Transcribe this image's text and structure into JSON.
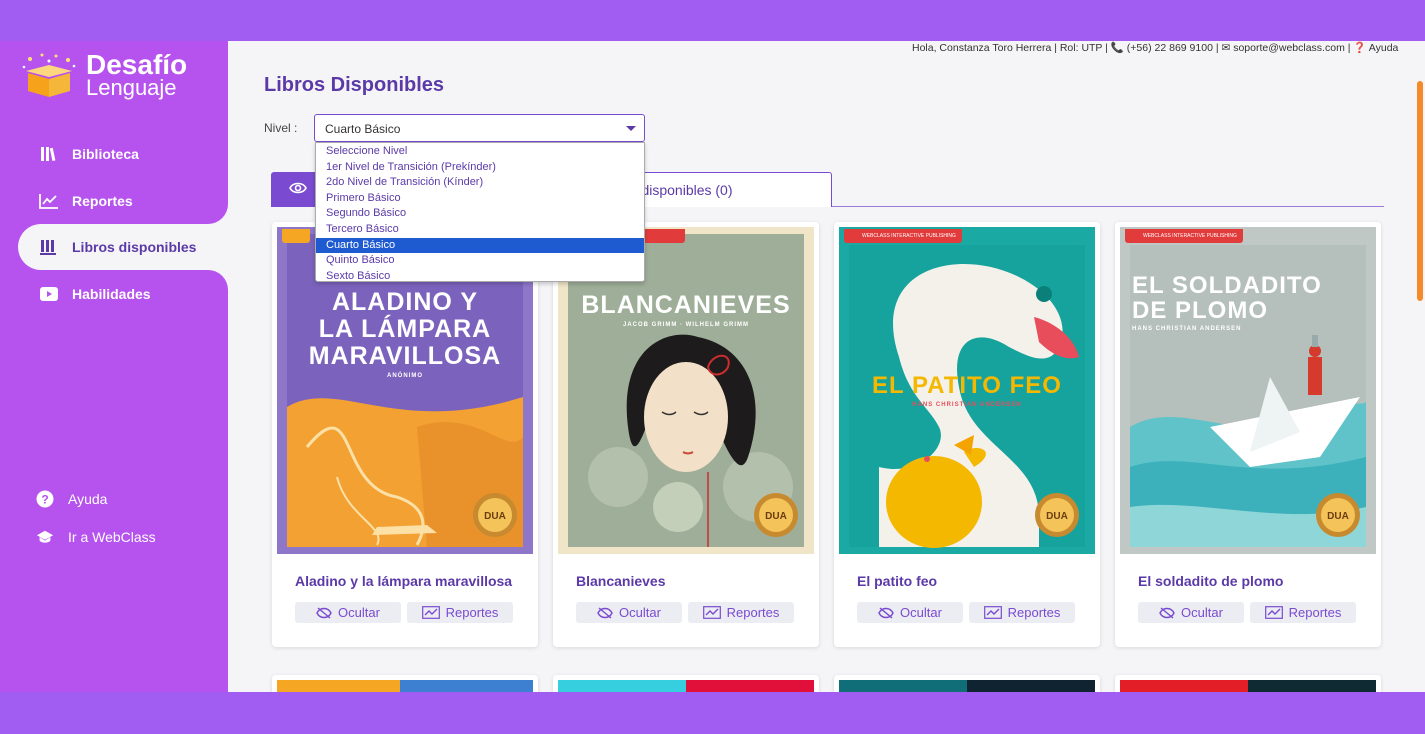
{
  "app": {
    "logo_line1": "Desafío",
    "logo_line2": "Lenguaje"
  },
  "topbar": {
    "text": "Hola, Constanza Toro Herrera | Rol: UTP | 📞 (+56) 22 869 9100 | ✉ soporte@webclass.com | ❓ Ayuda"
  },
  "sidebar": {
    "items": [
      {
        "label": "Biblioteca",
        "icon": "books-icon"
      },
      {
        "label": "Reportes",
        "icon": "chart-icon"
      },
      {
        "label": "Libros disponibles",
        "icon": "library-icon"
      },
      {
        "label": "Habilidades",
        "icon": "play-icon"
      }
    ],
    "bottom": [
      {
        "label": "Ayuda",
        "icon": "question-icon"
      },
      {
        "label": "Ir a WebClass",
        "icon": "graduation-cap-icon"
      }
    ]
  },
  "main": {
    "title": "Libros Disponibles",
    "nivel_label": "Nivel :",
    "nivel_selected": "Cuarto Básico",
    "nivel_options": [
      "Seleccione Nivel",
      "1er Nivel de Transición (Prekínder)",
      "2do Nivel de Transición (Kínder)",
      "Primero Básico",
      "Segundo Básico",
      "Tercero Básico",
      "Cuarto Básico",
      "Quinto Básico",
      "Sexto Básico"
    ],
    "tab_hidden_label": "no disponibles (0)",
    "books": [
      {
        "title": "Aladino y la lámpara maravillosa",
        "cover_title": [
          "ALADINO Y",
          "LA LÁMPARA",
          "MARAVILLOSA"
        ],
        "cover_author": "ANÓNIMO"
      },
      {
        "title": "Blancanieves",
        "cover_title": [
          "BLANCANIEVES"
        ],
        "cover_author": "JACOB GRIMM · WILHELM GRIMM"
      },
      {
        "title": "El patito feo",
        "cover_title": [
          "EL PATITO FEO"
        ],
        "cover_author": "HANS CHRISTIAN ANDERSEN"
      },
      {
        "title": "El soldadito de plomo",
        "cover_title": [
          "EL SOLDADITO",
          "DE PLOMO"
        ],
        "cover_author": "HANS CHRISTIAN ANDERSEN"
      }
    ],
    "btn_hide": "Ocultar",
    "btn_reports": "Reportes",
    "publisher": "WEBCLASS INTERACTIVE PUBLISHING",
    "badge": "DUA"
  },
  "colors": {
    "brand_purple": "#b652ee",
    "accent": "#5b3aa8",
    "outer_bg": "#a15cf2"
  }
}
